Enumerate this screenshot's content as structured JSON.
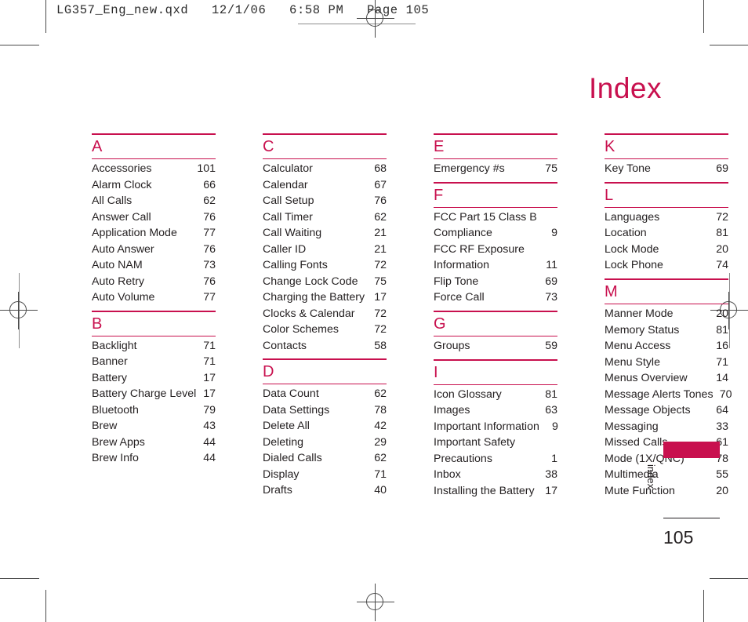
{
  "file_header": "LG357_Eng_new.qxd   12/1/06   6:58 PM   Page 105",
  "page_title": "Index",
  "side_tab_label": "index",
  "page_number": "105",
  "colors": {
    "accent": "#c8104e",
    "text": "#231f20",
    "mark": "#4a4a4a"
  },
  "columns": [
    {
      "sections": [
        {
          "letter": "A",
          "entries": [
            {
              "label": "Accessories",
              "page": "101"
            },
            {
              "label": "Alarm Clock",
              "page": "66"
            },
            {
              "label": "All Calls",
              "page": "62"
            },
            {
              "label": "Answer Call",
              "page": "76"
            },
            {
              "label": "Application Mode",
              "page": "77"
            },
            {
              "label": "Auto Answer",
              "page": "76"
            },
            {
              "label": "Auto NAM",
              "page": "73"
            },
            {
              "label": "Auto Retry",
              "page": "76"
            },
            {
              "label": "Auto Volume",
              "page": "77"
            }
          ]
        },
        {
          "letter": "B",
          "entries": [
            {
              "label": "Backlight",
              "page": "71"
            },
            {
              "label": "Banner",
              "page": "71"
            },
            {
              "label": "Battery",
              "page": "17"
            },
            {
              "label": "Battery Charge Level",
              "page": "17"
            },
            {
              "label": "Bluetooth",
              "page": "79"
            },
            {
              "label": "Brew",
              "page": "43"
            },
            {
              "label": "Brew Apps",
              "page": "44"
            },
            {
              "label": "Brew Info",
              "page": "44"
            }
          ]
        }
      ]
    },
    {
      "sections": [
        {
          "letter": "C",
          "entries": [
            {
              "label": "Calculator",
              "page": "68"
            },
            {
              "label": "Calendar",
              "page": "67"
            },
            {
              "label": "Call Setup",
              "page": "76"
            },
            {
              "label": "Call Timer",
              "page": "62"
            },
            {
              "label": "Call Waiting",
              "page": "21"
            },
            {
              "label": "Caller ID",
              "page": "21"
            },
            {
              "label": "Calling Fonts",
              "page": "72"
            },
            {
              "label": "Change Lock Code",
              "page": "75"
            },
            {
              "label": "Charging the Battery",
              "page": "17"
            },
            {
              "label": "Clocks & Calendar",
              "page": "72"
            },
            {
              "label": "Color Schemes",
              "page": "72"
            },
            {
              "label": "Contacts",
              "page": "58"
            }
          ]
        },
        {
          "letter": "D",
          "entries": [
            {
              "label": "Data Count",
              "page": "62"
            },
            {
              "label": "Data Settings",
              "page": "78"
            },
            {
              "label": "Delete All",
              "page": "42"
            },
            {
              "label": "Deleting",
              "page": "29"
            },
            {
              "label": "Dialed Calls",
              "page": "62"
            },
            {
              "label": "Display",
              "page": "71"
            },
            {
              "label": "Drafts",
              "page": "40"
            }
          ]
        }
      ]
    },
    {
      "sections": [
        {
          "letter": "E",
          "entries": [
            {
              "label": "Emergency #s",
              "page": "75"
            }
          ]
        },
        {
          "letter": "F",
          "entries": [
            {
              "label": "FCC Part 15 Class B",
              "page": ""
            },
            {
              "label": "Compliance",
              "page": "9"
            },
            {
              "label": "FCC RF Exposure",
              "page": ""
            },
            {
              "label": "Information",
              "page": "11"
            },
            {
              "label": "Flip Tone",
              "page": "69"
            },
            {
              "label": "Force Call",
              "page": "73"
            }
          ]
        },
        {
          "letter": "G",
          "entries": [
            {
              "label": "Groups",
              "page": "59"
            }
          ]
        },
        {
          "letter": "I",
          "entries": [
            {
              "label": "Icon Glossary",
              "page": "81"
            },
            {
              "label": "Images",
              "page": "63"
            },
            {
              "label": "Important Information",
              "page": "9"
            },
            {
              "label": "Important Safety",
              "page": ""
            },
            {
              "label": "Precautions",
              "page": "1"
            },
            {
              "label": "Inbox",
              "page": "38"
            },
            {
              "label": "Installing the Battery",
              "page": "17"
            }
          ]
        }
      ]
    },
    {
      "sections": [
        {
          "letter": "K",
          "entries": [
            {
              "label": "Key Tone",
              "page": "69"
            }
          ]
        },
        {
          "letter": "L",
          "entries": [
            {
              "label": "Languages",
              "page": "72"
            },
            {
              "label": "Location",
              "page": "81"
            },
            {
              "label": "Lock Mode",
              "page": "20"
            },
            {
              "label": "Lock Phone",
              "page": "74"
            }
          ]
        },
        {
          "letter": "M",
          "entries": [
            {
              "label": "Manner Mode",
              "page": "20"
            },
            {
              "label": "Memory Status",
              "page": "81"
            },
            {
              "label": "Menu Access",
              "page": "16"
            },
            {
              "label": "Menu Style",
              "page": "71"
            },
            {
              "label": "Menus Overview",
              "page": "14"
            },
            {
              "label": "Message Alerts Tones",
              "page": "70"
            },
            {
              "label": "Message Objects",
              "page": "64"
            },
            {
              "label": "Messaging",
              "page": "33"
            },
            {
              "label": "Missed Calls",
              "page": "61"
            },
            {
              "label": "Mode (1X/QNC)",
              "page": "78"
            },
            {
              "label": "Multimedia",
              "page": "55"
            },
            {
              "label": "Mute Function",
              "page": "20"
            }
          ]
        }
      ]
    }
  ]
}
